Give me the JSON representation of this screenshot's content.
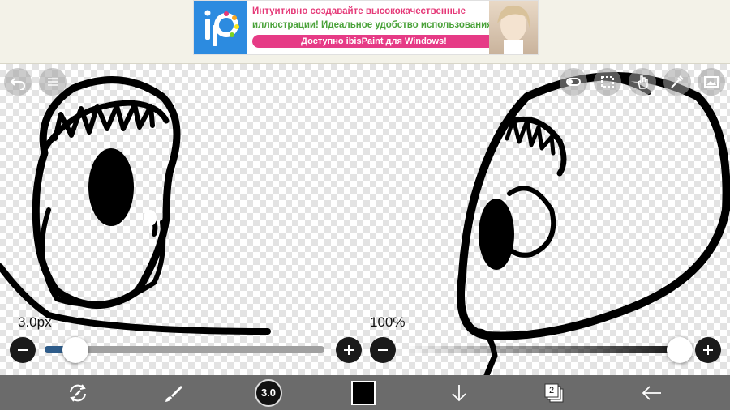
{
  "ad": {
    "line1": "Интуитивно создавайте высококачественные",
    "line2": "иллюстрации! Идеальное удобство использования!",
    "cta": "Доступно ibisPaint для Windows!"
  },
  "canvas": {
    "top_buttons": [
      {
        "name": "undo-button",
        "icon": "undo-icon"
      },
      {
        "name": "redo-button",
        "icon": "redo-icon"
      }
    ],
    "right_buttons": [
      {
        "name": "toggle-button",
        "icon": "toggle-icon"
      },
      {
        "name": "selection-button",
        "icon": "selection-icon"
      },
      {
        "name": "hand-tool-button",
        "icon": "hand-icon"
      },
      {
        "name": "eyedropper-button",
        "icon": "eyedropper-icon"
      },
      {
        "name": "reference-button",
        "icon": "image-icon"
      }
    ]
  },
  "brush": {
    "size_label": "3.0px",
    "size_fraction": 0.1,
    "accent": "#2e5c8a"
  },
  "opacity": {
    "label": "100%",
    "fraction": 1.0
  },
  "toolbar": {
    "brush_size_value": "3.0",
    "layer_count": "2",
    "color": "#000000",
    "items": [
      "transform-icon",
      "brush-icon",
      "brush-size",
      "color",
      "down-arrow-icon",
      "layers-icon",
      "back-arrow-icon"
    ]
  }
}
